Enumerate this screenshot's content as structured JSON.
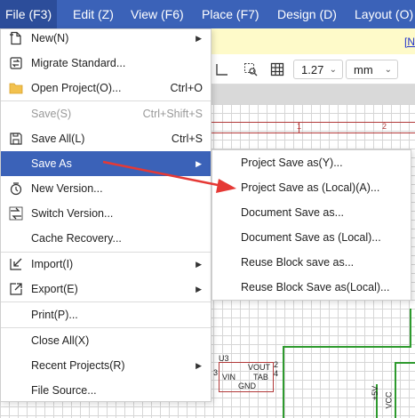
{
  "menubar": {
    "items": [
      "File (F3)",
      "Edit (Z)",
      "View (F6)",
      "Place (F7)",
      "Design (D)",
      "Layout (O)"
    ]
  },
  "yellow_bar": {
    "tab_text": "[N"
  },
  "toolbar": {
    "grid_value": "1.27",
    "unit_value": "mm"
  },
  "file_menu": {
    "items": [
      {
        "label": "New(N)",
        "shortcut": "",
        "icon": "new-file-icon"
      },
      {
        "label": "Migrate Standard...",
        "shortcut": "",
        "icon": "migrate-icon"
      },
      {
        "label": "Open Project(O)...",
        "shortcut": "Ctrl+O",
        "icon": "folder-icon"
      },
      {
        "label": "Save(S)",
        "shortcut": "Ctrl+Shift+S",
        "icon": ""
      },
      {
        "label": "Save All(L)",
        "shortcut": "Ctrl+S",
        "icon": "save-icon"
      },
      {
        "label": "Save As",
        "shortcut": "",
        "icon": ""
      },
      {
        "label": "New Version...",
        "shortcut": "",
        "icon": "new-version-icon"
      },
      {
        "label": "Switch Version...",
        "shortcut": "",
        "icon": "switch-version-icon"
      },
      {
        "label": "Cache Recovery...",
        "shortcut": "",
        "icon": ""
      },
      {
        "label": "Import(I)",
        "shortcut": "",
        "icon": "import-icon"
      },
      {
        "label": "Export(E)",
        "shortcut": "",
        "icon": "export-icon"
      },
      {
        "label": "Print(P)...",
        "shortcut": "",
        "icon": ""
      },
      {
        "label": "Close All(X)",
        "shortcut": "",
        "icon": ""
      },
      {
        "label": "Recent Projects(R)",
        "shortcut": "",
        "icon": ""
      },
      {
        "label": "File Source...",
        "shortcut": "",
        "icon": ""
      }
    ]
  },
  "save_as_submenu": {
    "items": [
      "Project Save as(Y)...",
      "Project Save as (Local)(A)...",
      "Document Save as...",
      "Document Save as (Local)...",
      "Reuse Block save as...",
      "Reuse Block Save as(Local)..."
    ]
  },
  "schematic": {
    "ruler_1": "1",
    "ruler_2": "2",
    "ref": "U3",
    "pin_vin": "VIN",
    "pin_vout": "VOUT",
    "pin_tab": "TAB",
    "pin_gnd": "GND",
    "pin_n2": "2",
    "pin_n3": "3",
    "pin_n4": "4",
    "net_5v": "+5V",
    "net_vcc": "VCC"
  },
  "colors": {
    "accent": "#3b62b8",
    "wire": "#2e9a2e",
    "frame": "#b23a3a",
    "arrow": "#e53935"
  }
}
